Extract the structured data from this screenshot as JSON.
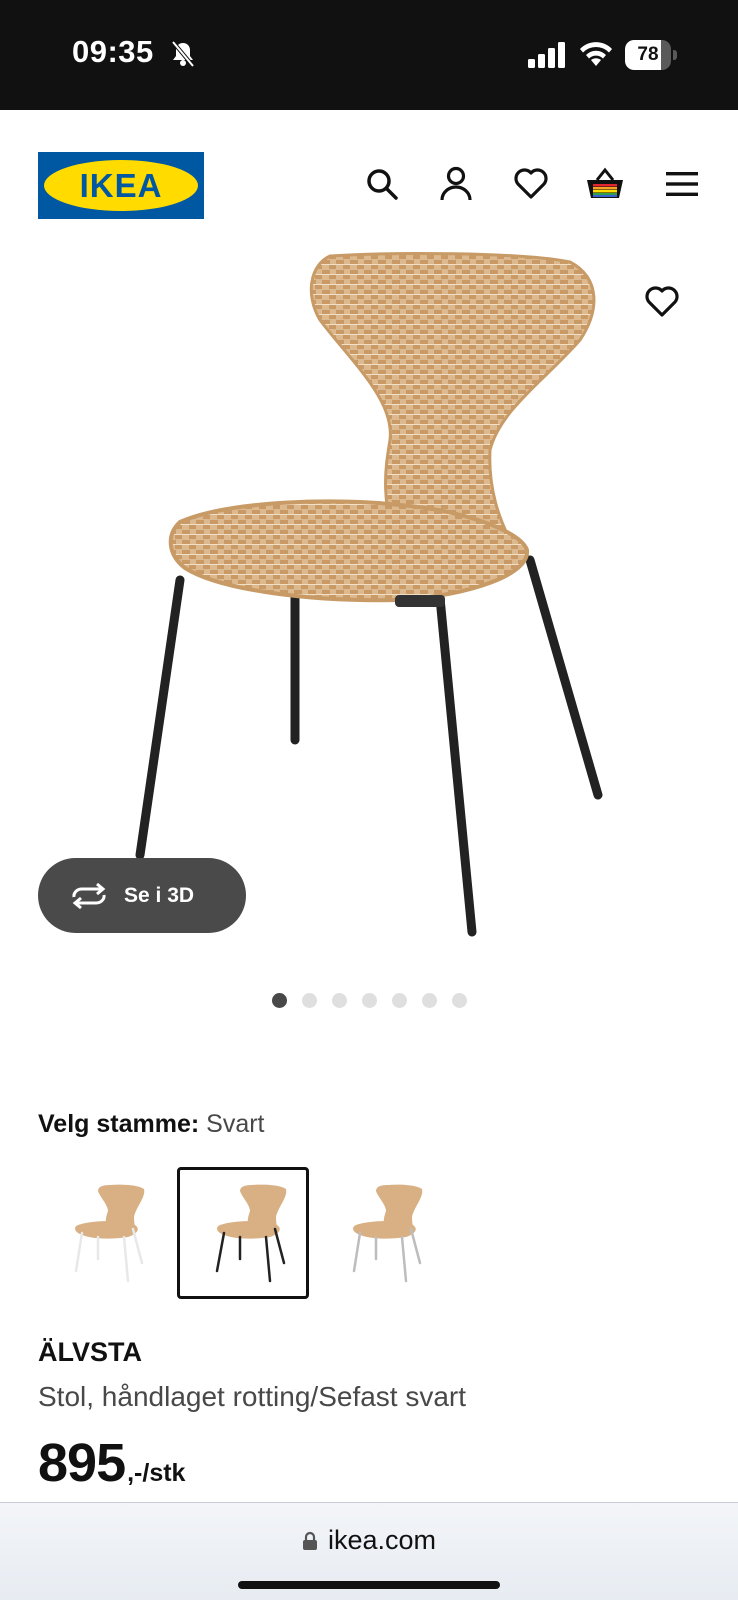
{
  "status_bar": {
    "time": "09:35",
    "battery_level": "78",
    "battery_fraction": 0.78
  },
  "header": {
    "logo_text": "IKEA",
    "icons": [
      "search-icon",
      "account-icon",
      "heart-icon",
      "basket-icon",
      "menu-icon"
    ]
  },
  "gallery": {
    "view_3d_label": "Se i 3D",
    "dot_count": 7,
    "active_dot": 0
  },
  "stem_selector": {
    "label": "Velg stamme:",
    "value": "Svart",
    "options": [
      "Hvit",
      "Svart",
      "Sølv"
    ],
    "selected_index": 1
  },
  "product": {
    "name": "ÄLVSTA",
    "description": "Stol, håndlaget rotting/Sefast svart",
    "price": "895",
    "price_suffix": ",-/stk"
  },
  "browser": {
    "url": "ikea.com"
  },
  "colors": {
    "ikea_blue": "#0058a3",
    "ikea_yellow": "#ffdb00",
    "rattan": "#d9b48a",
    "frame_black": "#222222"
  }
}
